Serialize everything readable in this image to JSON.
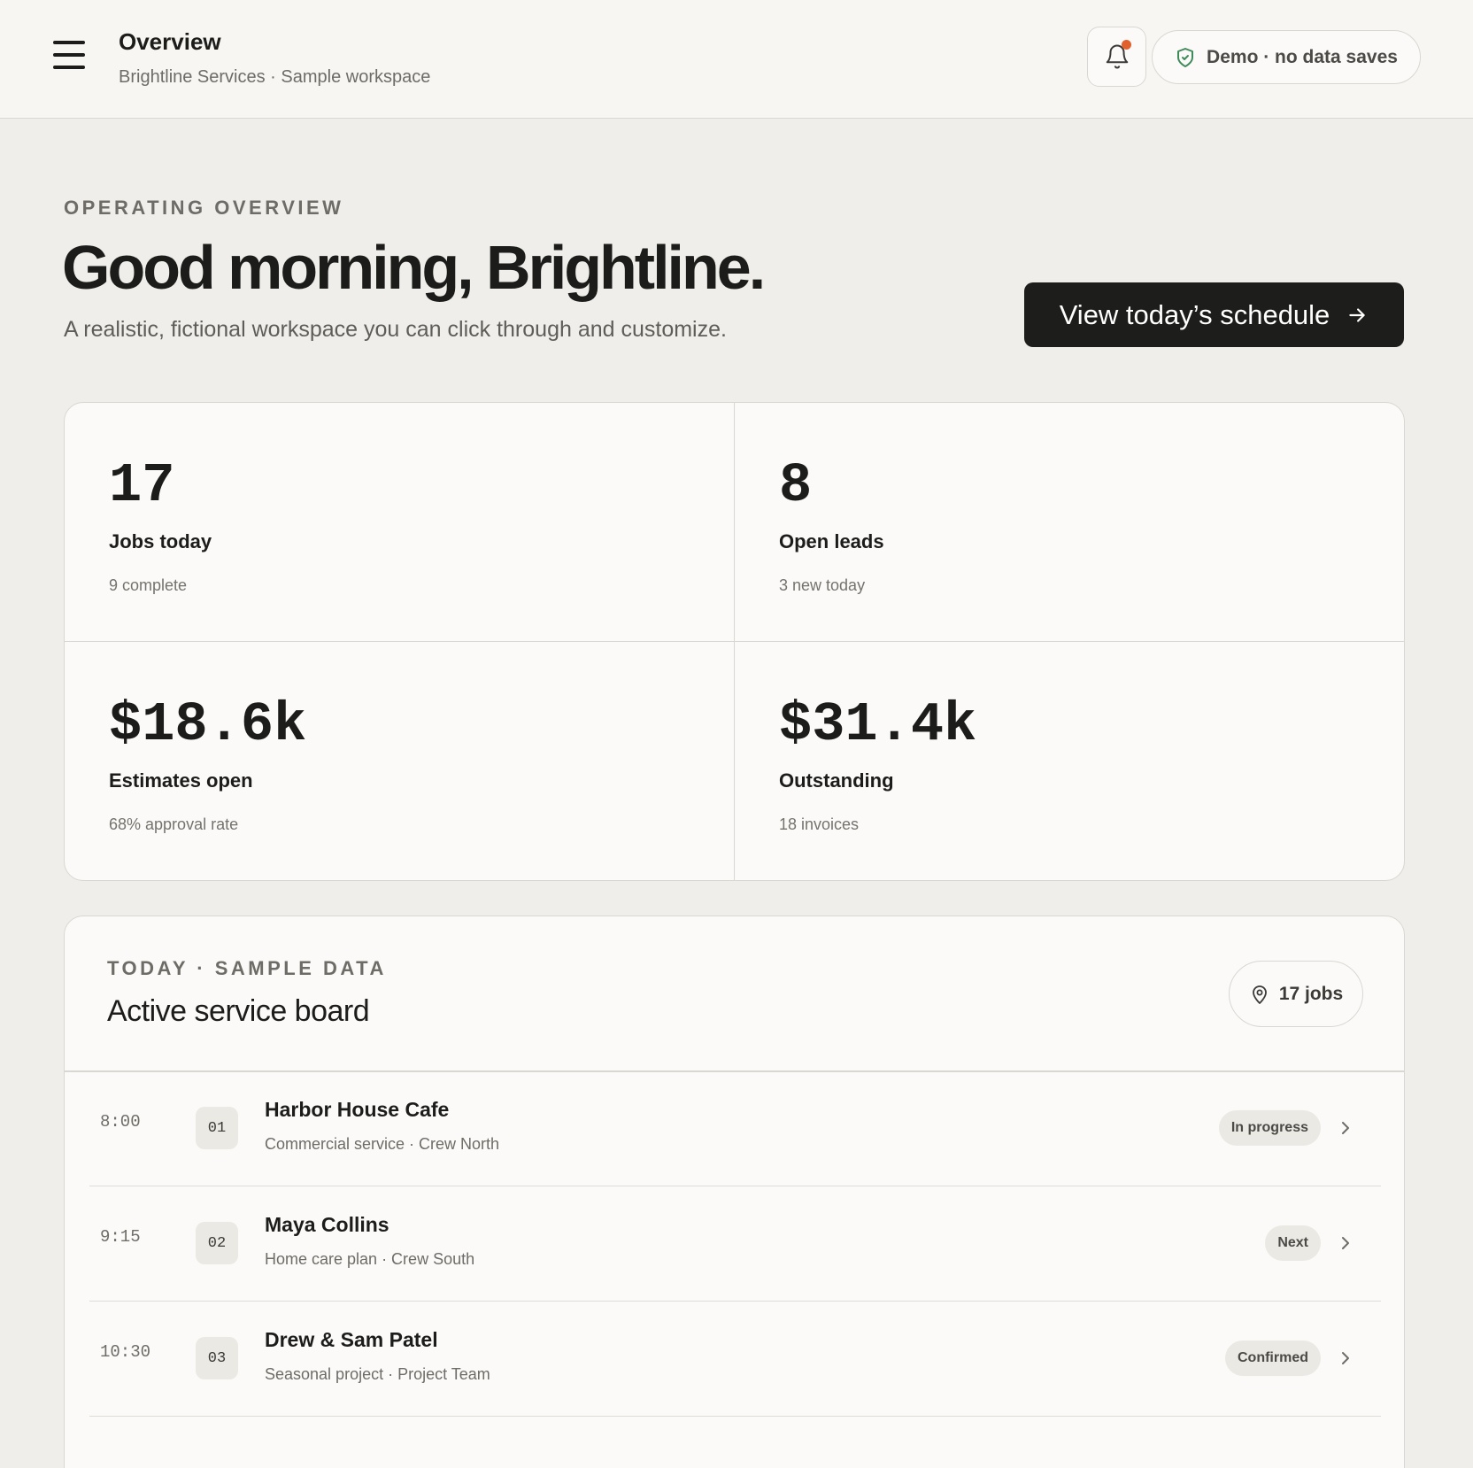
{
  "topbar": {
    "title": "Overview",
    "subtitle": "Brightline Services · Sample workspace",
    "demo_label": "Demo · no data saves"
  },
  "hero": {
    "eyebrow": "OPERATING OVERVIEW",
    "title": "Good morning, Brightline.",
    "subtitle": "A realistic, fictional workspace you can click through and customize.",
    "cta_label": "View today’s schedule"
  },
  "stats": [
    {
      "value": "17",
      "label": "Jobs today",
      "note": "9 complete"
    },
    {
      "value": "8",
      "label": "Open leads",
      "note": "3 new today"
    },
    {
      "value": "$18.6k",
      "label": "Estimates open",
      "note": "68% approval rate"
    },
    {
      "value": "$31.4k",
      "label": "Outstanding",
      "note": "18 invoices"
    }
  ],
  "board": {
    "eyebrow": "TODAY · SAMPLE DATA",
    "title": "Active service board",
    "jobs_label": "17 jobs",
    "rows": [
      {
        "time": "8:00",
        "num": "01",
        "name": "Harbor House Cafe",
        "meta": "Commercial service · Crew North",
        "status": "In progress"
      },
      {
        "time": "9:15",
        "num": "02",
        "name": "Maya Collins",
        "meta": "Home care plan · Crew South",
        "status": "Next"
      },
      {
        "time": "10:30",
        "num": "03",
        "name": "Drew & Sam Patel",
        "meta": "Seasonal project · Project Team",
        "status": "Confirmed"
      }
    ]
  },
  "colors": {
    "accent_dot": "#e0612e",
    "shield": "#3f8a5a",
    "cta_bg": "#1d1d1b"
  },
  "icons": {
    "menu": "hamburger-icon",
    "bell": "bell-icon",
    "shield": "shield-check-icon",
    "cta_arrow": "arrow-right-icon",
    "pin": "map-pin-icon",
    "row_chevron": "chevron-right-icon"
  }
}
